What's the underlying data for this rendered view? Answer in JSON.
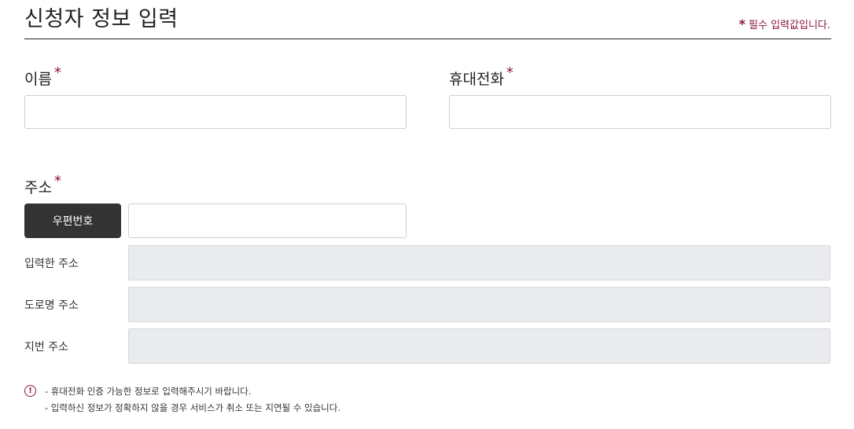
{
  "header": {
    "title": "신청자 정보 입력",
    "required_star": "*",
    "required_note": "필수 입력값입니다."
  },
  "form": {
    "name": {
      "label": "이름",
      "required_mark": "*",
      "value": ""
    },
    "phone": {
      "label": "휴대전화",
      "required_mark": "*",
      "value": ""
    },
    "address": {
      "label": "주소",
      "required_mark": "*",
      "zip_button": "우편번호",
      "zip_value": "",
      "entered_label": "입력한 주소",
      "road_label": "도로명 주소",
      "lot_label": "지번 주소"
    }
  },
  "notice": {
    "icon": "exclamation-icon",
    "lines": [
      "- 휴대전화 인증 가능한 정보로 입력해주시기 바랍니다.",
      "- 입력하신 정보가 정확하지 않을 경우 서비스가 취소 또는 지연될 수 있습니다."
    ]
  },
  "colors": {
    "accent": "#8a1538",
    "button_bg": "#333333",
    "readonly_bg": "#e9ebee"
  }
}
